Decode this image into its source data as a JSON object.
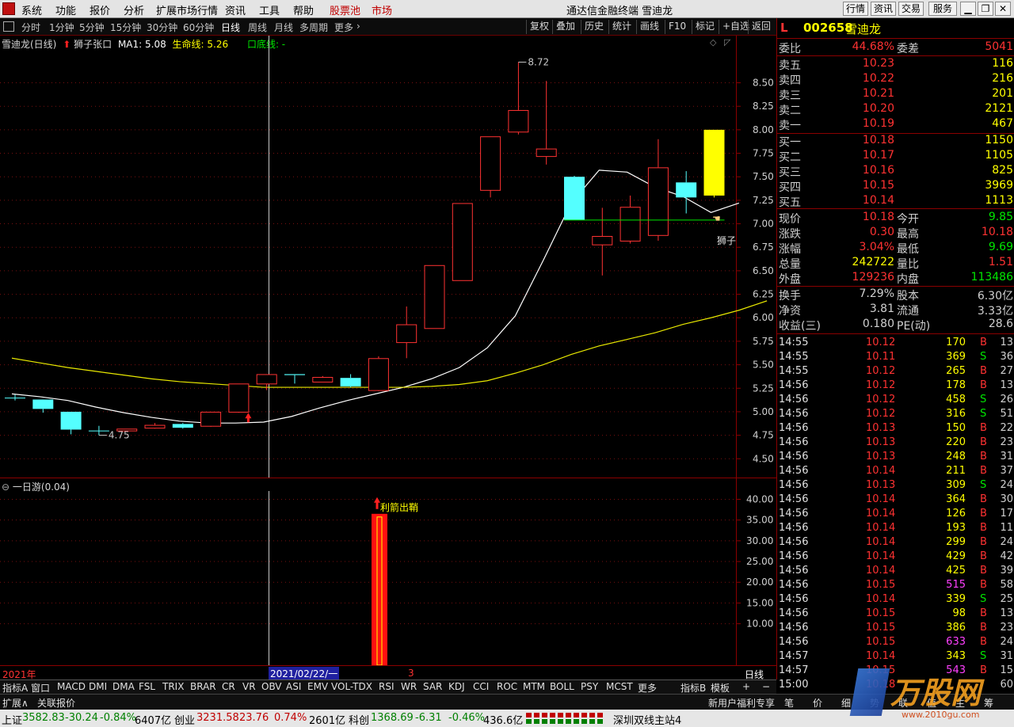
{
  "menubar": {
    "items": [
      "系统",
      "功能",
      "报价",
      "分析",
      "扩展市场行情",
      "资讯",
      "工具",
      "帮助"
    ],
    "pool_label": "股票池",
    "market_label": "市场",
    "window_title": "通达信金融终端  雪迪龙",
    "right_buttons": [
      "行情",
      "资讯",
      "交易",
      "服务"
    ]
  },
  "periodbar": {
    "items": [
      "分时",
      "1分钟",
      "5分钟",
      "15分钟",
      "30分钟",
      "60分钟",
      "日线",
      "周线",
      "月线",
      "多周期",
      "更多"
    ],
    "active": "日线",
    "tools": [
      "复权",
      "叠加",
      "历史",
      "统计",
      "画线",
      "F10",
      "标记",
      "+自选",
      "返回"
    ]
  },
  "chart_header": {
    "name": "雪迪龙(日线)",
    "indicator": "狮子张口",
    "ma1": "MA1: 5.08",
    "life_line": "生命线: 5.26",
    "bottom_line": "口底线: -"
  },
  "sub_header": "一日游(0.04)",
  "chart_data": [
    {
      "type": "candlestick",
      "title": "雪迪龙(日线)",
      "ylim": [
        4.3,
        8.85
      ],
      "y_ticks": [
        4.5,
        4.75,
        5.0,
        5.25,
        5.5,
        5.75,
        6.0,
        6.25,
        6.5,
        6.75,
        7.0,
        7.25,
        7.5,
        7.75,
        8.0,
        8.25,
        8.5
      ],
      "candles": [
        {
          "open": 5.15,
          "close": 5.15,
          "high": 5.18,
          "low": 5.12,
          "color": "cyan"
        },
        {
          "open": 5.13,
          "close": 5.03,
          "high": 5.13,
          "low": 4.99,
          "color": "cyan"
        },
        {
          "open": 5.0,
          "close": 4.81,
          "high": 5.0,
          "low": 4.76,
          "color": "cyan"
        },
        {
          "open": 4.8,
          "close": 4.8,
          "high": 4.85,
          "low": 4.75,
          "color": "cyan"
        },
        {
          "open": 4.8,
          "close": 4.82,
          "high": 4.82,
          "low": 4.79,
          "color": "red"
        },
        {
          "open": 4.83,
          "close": 4.86,
          "high": 4.88,
          "low": 4.82,
          "color": "red"
        },
        {
          "open": 4.87,
          "close": 4.83,
          "high": 4.88,
          "low": 4.82,
          "color": "cyan"
        },
        {
          "open": 4.85,
          "close": 5.0,
          "high": 5.0,
          "low": 4.84,
          "color": "red"
        },
        {
          "open": 5.0,
          "close": 5.3,
          "high": 5.3,
          "low": 4.99,
          "color": "red"
        },
        {
          "open": 5.3,
          "close": 5.4,
          "high": 5.4,
          "low": 5.23,
          "color": "red"
        },
        {
          "open": 5.4,
          "close": 5.39,
          "high": 5.4,
          "low": 5.3,
          "color": "cyan"
        },
        {
          "open": 5.32,
          "close": 5.37,
          "high": 5.38,
          "low": 5.32,
          "color": "red"
        },
        {
          "open": 5.36,
          "close": 5.27,
          "high": 5.4,
          "low": 5.26,
          "color": "cyan"
        },
        {
          "open": 5.23,
          "close": 5.57,
          "high": 5.59,
          "low": 5.22,
          "color": "red"
        },
        {
          "open": 5.74,
          "close": 5.93,
          "high": 6.12,
          "low": 5.57,
          "color": "red"
        },
        {
          "open": 5.89,
          "close": 6.56,
          "high": 6.56,
          "low": 5.89,
          "color": "red"
        },
        {
          "open": 6.4,
          "close": 7.22,
          "high": 7.22,
          "low": 6.4,
          "color": "red"
        },
        {
          "open": 7.36,
          "close": 7.93,
          "high": 7.93,
          "low": 7.28,
          "color": "red"
        },
        {
          "open": 7.98,
          "close": 8.21,
          "high": 8.72,
          "low": 7.95,
          "color": "red"
        },
        {
          "open": 7.72,
          "close": 7.8,
          "high": 8.52,
          "low": 7.63,
          "color": "red"
        },
        {
          "open": 7.5,
          "close": 7.04,
          "high": 7.51,
          "low": 7.04,
          "color": "cyan"
        },
        {
          "open": 6.78,
          "close": 6.87,
          "high": 7.17,
          "low": 6.45,
          "color": "red"
        },
        {
          "open": 6.82,
          "close": 7.18,
          "high": 7.3,
          "low": 6.79,
          "color": "red"
        },
        {
          "open": 6.88,
          "close": 7.6,
          "high": 7.9,
          "low": 6.82,
          "color": "red"
        },
        {
          "open": 7.44,
          "close": 7.28,
          "high": 7.56,
          "low": 7.11,
          "color": "cyan"
        },
        {
          "open": 7.3,
          "close": 8.0,
          "high": 8.0,
          "low": 7.28,
          "color": "yellow"
        }
      ],
      "series": [
        {
          "name": "MA1",
          "color": "#ffffff",
          "values": [
            5.19,
            5.16,
            5.12,
            5.05,
            4.99,
            4.94,
            4.9,
            4.88,
            4.88,
            4.89,
            4.95,
            5.04,
            5.12,
            5.19,
            5.26,
            5.35,
            5.47,
            5.68,
            6.02,
            6.61,
            7.22,
            7.57,
            7.55,
            7.39,
            7.29,
            7.12,
            7.22
          ]
        },
        {
          "name": "生命线",
          "color": "#e8e800",
          "values": [
            5.57,
            5.52,
            5.47,
            5.43,
            5.39,
            5.35,
            5.32,
            5.3,
            5.28,
            5.26,
            5.26,
            5.26,
            5.26,
            5.26,
            5.26,
            5.27,
            5.29,
            5.33,
            5.41,
            5.5,
            5.61,
            5.7,
            5.77,
            5.84,
            5.93,
            6.0,
            6.08,
            6.18
          ]
        }
      ],
      "annotations": [
        {
          "text": "8.72"
        },
        {
          "text": "4.75"
        },
        {
          "text": "狮子"
        }
      ]
    },
    {
      "type": "bar",
      "title": "一日游(0.04)",
      "ylim": [
        0,
        42
      ],
      "y_ticks": [
        10.0,
        15.0,
        20.0,
        25.0,
        30.0,
        35.0,
        40.0
      ],
      "bars": [
        {
          "value": 36.5,
          "color": "red"
        }
      ],
      "annotations": [
        {
          "text": "利箭出鞘"
        }
      ]
    }
  ],
  "time_axis": {
    "year": "2021年",
    "cursor_date": "2021/02/22/一",
    "month": "3",
    "period": "日线"
  },
  "quote": {
    "mark": "L",
    "code": "002658",
    "name": "雪迪龙",
    "weibi_label": "委比",
    "weibi": "44.68%",
    "weicha_label": "委差",
    "weicha": "5041",
    "sell": [
      {
        "label": "卖五",
        "price": "10.23",
        "vol": "116"
      },
      {
        "label": "卖四",
        "price": "10.22",
        "vol": "216"
      },
      {
        "label": "卖三",
        "price": "10.21",
        "vol": "201"
      },
      {
        "label": "卖二",
        "price": "10.20",
        "vol": "2121"
      },
      {
        "label": "卖一",
        "price": "10.19",
        "vol": "467"
      }
    ],
    "buy": [
      {
        "label": "买一",
        "price": "10.18",
        "vol": "1150"
      },
      {
        "label": "买二",
        "price": "10.17",
        "vol": "1105"
      },
      {
        "label": "买三",
        "price": "10.16",
        "vol": "825"
      },
      {
        "label": "买四",
        "price": "10.15",
        "vol": "3969"
      },
      {
        "label": "买五",
        "price": "10.14",
        "vol": "1113"
      }
    ],
    "stats": [
      {
        "l1": "现价",
        "v1": "10.18",
        "c1": "#ff3232",
        "l2": "今开",
        "v2": "9.85",
        "c2": "#00e600"
      },
      {
        "l1": "涨跌",
        "v1": "0.30",
        "c1": "#ff3232",
        "l2": "最高",
        "v2": "10.18",
        "c2": "#ff3232"
      },
      {
        "l1": "涨幅",
        "v1": "3.04%",
        "c1": "#ff3232",
        "l2": "最低",
        "v2": "9.69",
        "c2": "#00e600"
      },
      {
        "l1": "总量",
        "v1": "242722",
        "c1": "#ffff00",
        "l2": "量比",
        "v2": "1.51",
        "c2": "#ff3232"
      },
      {
        "l1": "外盘",
        "v1": "129236",
        "c1": "#ff3232",
        "l2": "内盘",
        "v2": "113486",
        "c2": "#00e600"
      }
    ],
    "stats2": [
      {
        "l1": "换手",
        "v1": "7.29%",
        "l2": "股本",
        "v2": "6.30亿"
      },
      {
        "l1": "净资",
        "v1": "3.81",
        "l2": "流通",
        "v2": "3.33亿"
      },
      {
        "l1": "收益(三)",
        "v1": "0.180",
        "l2": "PE(动)",
        "v2": "28.6"
      }
    ]
  },
  "ticks": [
    {
      "t": "14:55",
      "p": "10.12",
      "v": "170",
      "s": "B",
      "n": "13"
    },
    {
      "t": "14:55",
      "p": "10.11",
      "v": "369",
      "s": "S",
      "n": "36"
    },
    {
      "t": "14:55",
      "p": "10.12",
      "v": "265",
      "s": "B",
      "n": "27"
    },
    {
      "t": "14:56",
      "p": "10.12",
      "v": "178",
      "s": "B",
      "n": "13"
    },
    {
      "t": "14:56",
      "p": "10.12",
      "v": "458",
      "s": "S",
      "n": "26"
    },
    {
      "t": "14:56",
      "p": "10.12",
      "v": "316",
      "s": "S",
      "n": "51"
    },
    {
      "t": "14:56",
      "p": "10.13",
      "v": "150",
      "s": "B",
      "n": "22"
    },
    {
      "t": "14:56",
      "p": "10.13",
      "v": "220",
      "s": "B",
      "n": "23"
    },
    {
      "t": "14:56",
      "p": "10.13",
      "v": "248",
      "s": "B",
      "n": "31"
    },
    {
      "t": "14:56",
      "p": "10.14",
      "v": "211",
      "s": "B",
      "n": "37"
    },
    {
      "t": "14:56",
      "p": "10.13",
      "v": "309",
      "s": "S",
      "n": "24"
    },
    {
      "t": "14:56",
      "p": "10.14",
      "v": "364",
      "s": "B",
      "n": "30"
    },
    {
      "t": "14:56",
      "p": "10.14",
      "v": "126",
      "s": "B",
      "n": "17"
    },
    {
      "t": "14:56",
      "p": "10.14",
      "v": "193",
      "s": "B",
      "n": "11"
    },
    {
      "t": "14:56",
      "p": "10.14",
      "v": "299",
      "s": "B",
      "n": "24"
    },
    {
      "t": "14:56",
      "p": "10.14",
      "v": "429",
      "s": "B",
      "n": "42"
    },
    {
      "t": "14:56",
      "p": "10.14",
      "v": "425",
      "s": "B",
      "n": "39"
    },
    {
      "t": "14:56",
      "p": "10.15",
      "v": "515",
      "s": "B",
      "n": "58"
    },
    {
      "t": "14:56",
      "p": "10.14",
      "v": "339",
      "s": "S",
      "n": "25"
    },
    {
      "t": "14:56",
      "p": "10.15",
      "v": "98",
      "s": "B",
      "n": "13"
    },
    {
      "t": "14:56",
      "p": "10.15",
      "v": "386",
      "s": "B",
      "n": "23"
    },
    {
      "t": "14:56",
      "p": "10.15",
      "v": "633",
      "s": "B",
      "n": "24"
    },
    {
      "t": "14:57",
      "p": "10.14",
      "v": "343",
      "s": "S",
      "n": "31"
    },
    {
      "t": "14:57",
      "p": "10.15",
      "v": "543",
      "s": "B",
      "n": "15"
    },
    {
      "t": "15:00",
      "p": "10.18",
      "v": "",
      "s": "",
      "n": "60"
    }
  ],
  "bottom_tabs": [
    "指标A",
    "窗口",
    "MACD",
    "DMI",
    "DMA",
    "FSL",
    "TRIX",
    "BRAR",
    "CR",
    "VR",
    "OBV",
    "ASI",
    "EMV",
    "VOL-TDX",
    "RSI",
    "WR",
    "SAR",
    "KDJ",
    "CCI",
    "ROC",
    "MTM",
    "BOLL",
    "PSY",
    "MCST",
    "更多"
  ],
  "bottom_right": [
    "指标B",
    "模板"
  ],
  "row2": {
    "left1": "扩展∧",
    "left2": "关联报价",
    "promo": "新用户福利专享",
    "tabs": [
      "笔",
      "价",
      "细",
      "势",
      "联",
      "值",
      "主",
      "筹"
    ]
  },
  "status": {
    "sh_label": "上证",
    "sh_val": "3582.83",
    "sh_chg": "-30.24",
    "sh_pct": "-0.84%",
    "sh_amt": "6407亿",
    "cy_label": "创业",
    "cy_val": "3231.58",
    "cy_chg": "23.76",
    "cy_pct": "0.74%",
    "cy_amt": "2601亿",
    "kc_label": "科创",
    "kc_val": "1368.69",
    "kc_chg": "-6.31",
    "kc_pct": "-0.46%",
    "kc_amt": "436.6亿",
    "server": "深圳双线主站4"
  },
  "watermark": {
    "brand": "万股网",
    "url": "www.2010gu.com"
  }
}
